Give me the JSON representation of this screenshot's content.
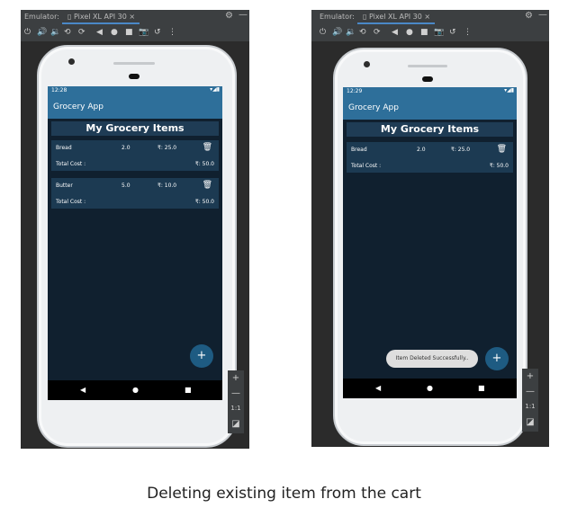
{
  "caption": "Deleting existing item from the cart",
  "emulator": {
    "label": "Emulator:",
    "device_tab": "Pixel XL API 30"
  },
  "left": {
    "status_time": "12:28",
    "app_title": "Grocery App",
    "header": "My Grocery Items",
    "items": [
      {
        "name": "Bread",
        "qty": "2.0",
        "price": "₹: 25.0",
        "total_label": "Total Cost :",
        "total": "₹: 50.0"
      },
      {
        "name": "Butter",
        "qty": "5.0",
        "price": "₹: 10.0",
        "total_label": "Total Cost :",
        "total": "₹: 50.0"
      }
    ],
    "fab": "+"
  },
  "right": {
    "status_time": "12:29",
    "app_title": "Grocery App",
    "header": "My Grocery Items",
    "items": [
      {
        "name": "Bread",
        "qty": "2.0",
        "price": "₹: 25.0",
        "total_label": "Total Cost :",
        "total": "₹: 50.0"
      }
    ],
    "toast": "Item Deleted Successfully..",
    "fab": "+"
  },
  "side_zoom": "1:1",
  "colors": {
    "app_bar": "#2e6f9a",
    "screen_bg": "#10202f",
    "card_bg": "#1c3a52",
    "fab": "#1e5b82"
  }
}
